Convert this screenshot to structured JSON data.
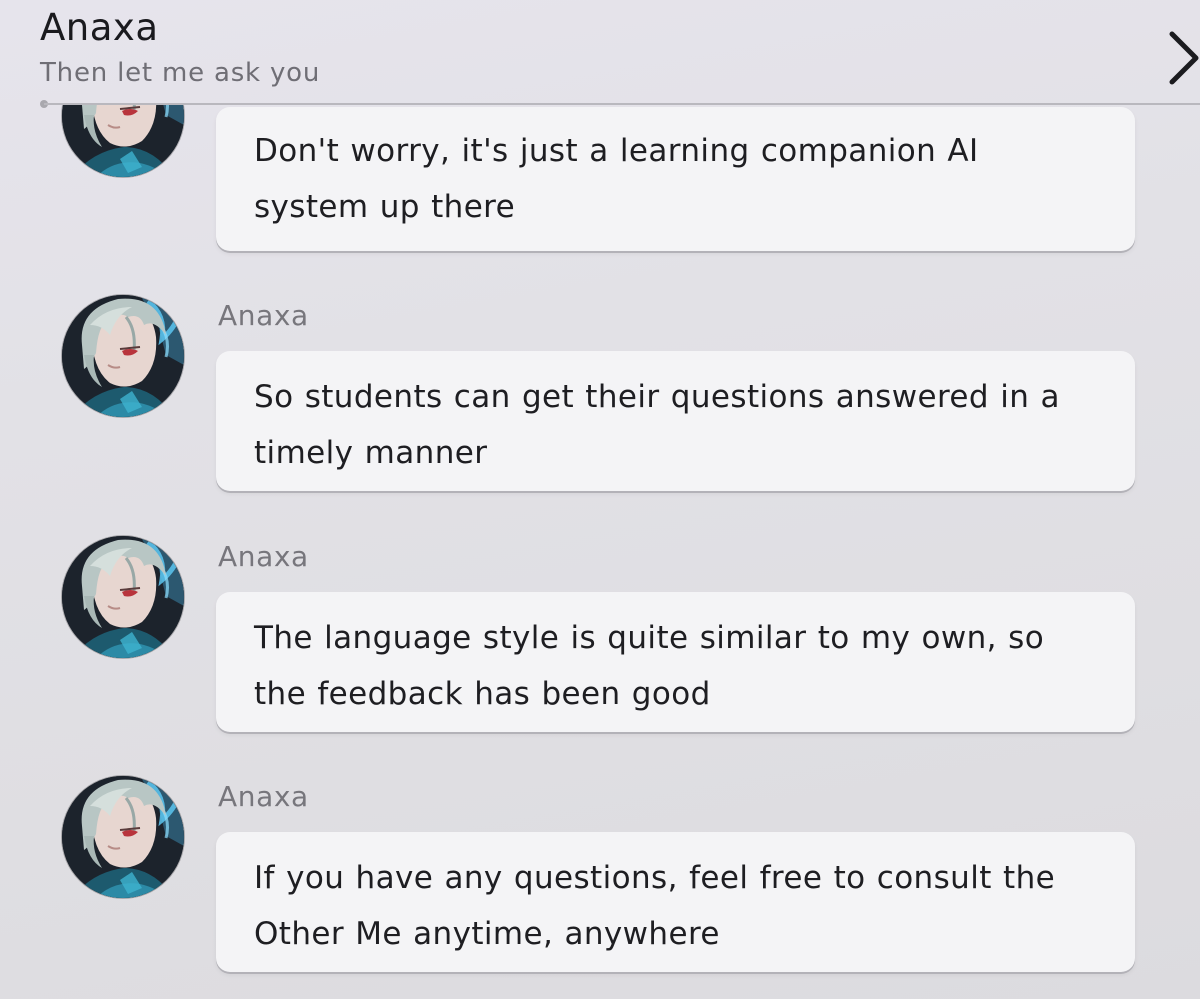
{
  "header": {
    "title": "Anaxa",
    "subtitle": "Then let me ask you",
    "next_icon": "chevron-right-icon"
  },
  "messages": [
    {
      "sender": "",
      "text": "Don't worry, it's just a learning companion AI system up there",
      "avatar_icon": "character-portrait"
    },
    {
      "sender": "Anaxa",
      "text": "So students can get their questions answered in a timely manner",
      "avatar_icon": "character-portrait"
    },
    {
      "sender": "Anaxa",
      "text": "The language style is quite similar to my own, so the feedback has been good",
      "avatar_icon": "character-portrait"
    },
    {
      "sender": "Anaxa",
      "text": "If you have any questions, feel free to consult the Other Me anytime, anywhere",
      "avatar_icon": "character-portrait"
    }
  ],
  "colors": {
    "background": "#e2e1e6",
    "bubble": "#f4f4f6",
    "text": "#1e1e22",
    "sender": "#77767c",
    "accent_glow": "#3fa9d8"
  }
}
